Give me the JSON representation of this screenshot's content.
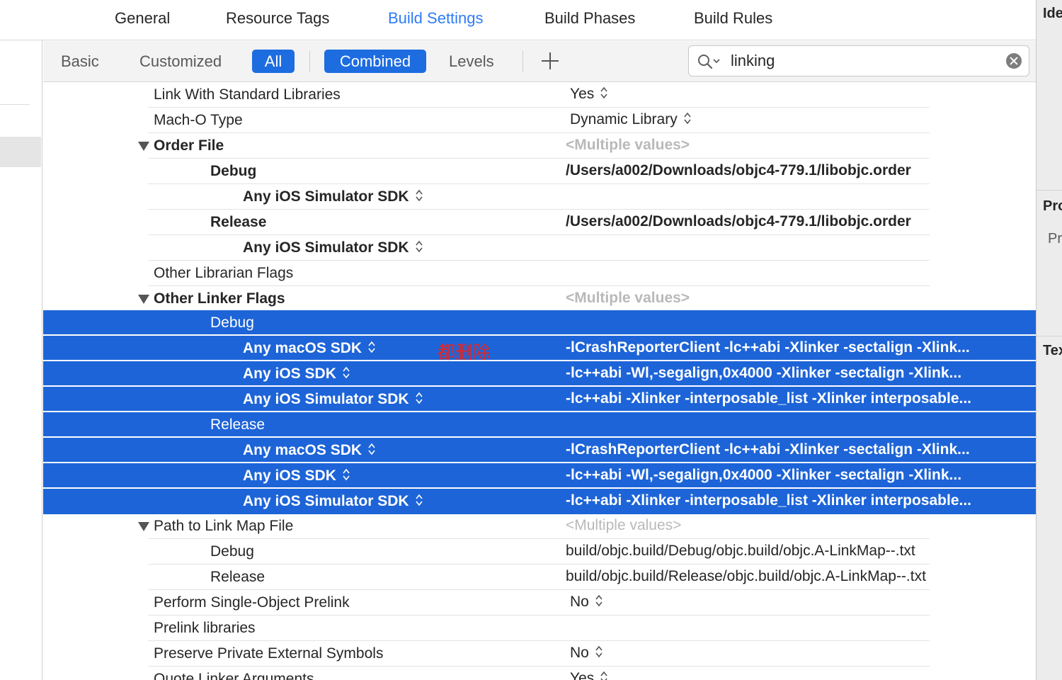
{
  "tabs": [
    "General",
    "Resource Tags",
    "Build Settings",
    "Build Phases",
    "Build Rules"
  ],
  "active_tab": "Build Settings",
  "filter": {
    "basic": "Basic",
    "customized": "Customized",
    "all": "All",
    "combined": "Combined",
    "levels": "Levels"
  },
  "search": {
    "value": "linking"
  },
  "annotation": "都删除",
  "inspector": {
    "identity": "Ide",
    "project": "Pro",
    "project_sub": "Pr",
    "text": "Tex"
  },
  "rows": [
    {
      "label": "Link With Standard Libraries",
      "value": "Yes",
      "stepper": true
    },
    {
      "label": "Mach-O Type",
      "value": "Dynamic Library",
      "stepper": true
    },
    {
      "label": "Order File",
      "value": "<Multiple values>"
    },
    {
      "label": "Debug",
      "value": "/Users/a002/Downloads/objc4-779.1/libobjc.order"
    },
    {
      "label": "Any iOS Simulator SDK",
      "value": ""
    },
    {
      "label": "Release",
      "value": "/Users/a002/Downloads/objc4-779.1/libobjc.order"
    },
    {
      "label": "Any iOS Simulator SDK",
      "value": ""
    },
    {
      "label": "Other Librarian Flags",
      "value": ""
    },
    {
      "label": "Other Linker Flags",
      "value": "<Multiple values>"
    },
    {
      "label": "Debug",
      "value": ""
    },
    {
      "label": "Any macOS SDK",
      "value": "-lCrashReporterClient -lc++abi -Xlinker -sectalign -Xlink..."
    },
    {
      "label": "Any iOS SDK",
      "value": "-lc++abi -Wl,-segalign,0x4000 -Xlinker -sectalign -Xlink..."
    },
    {
      "label": "Any iOS Simulator SDK",
      "value": "-lc++abi -Xlinker -interposable_list -Xlinker interposable..."
    },
    {
      "label": "Release",
      "value": ""
    },
    {
      "label": "Any macOS SDK",
      "value": "-lCrashReporterClient -lc++abi -Xlinker -sectalign -Xlink..."
    },
    {
      "label": "Any iOS SDK",
      "value": "-lc++abi -Wl,-segalign,0x4000 -Xlinker -sectalign -Xlink..."
    },
    {
      "label": "Any iOS Simulator SDK",
      "value": "-lc++abi -Xlinker -interposable_list -Xlinker interposable..."
    },
    {
      "label": "Path to Link Map File",
      "value": "<Multiple values>"
    },
    {
      "label": "Debug",
      "value": "build/objc.build/Debug/objc.build/objc.A-LinkMap--.txt"
    },
    {
      "label": "Release",
      "value": "build/objc.build/Release/objc.build/objc.A-LinkMap--.txt"
    },
    {
      "label": "Perform Single-Object Prelink",
      "value": "No",
      "stepper": true
    },
    {
      "label": "Prelink libraries",
      "value": ""
    },
    {
      "label": "Preserve Private External Symbols",
      "value": "No",
      "stepper": true
    },
    {
      "label": "Quote Linker Arguments",
      "value": "Yes",
      "stepper": true
    }
  ]
}
